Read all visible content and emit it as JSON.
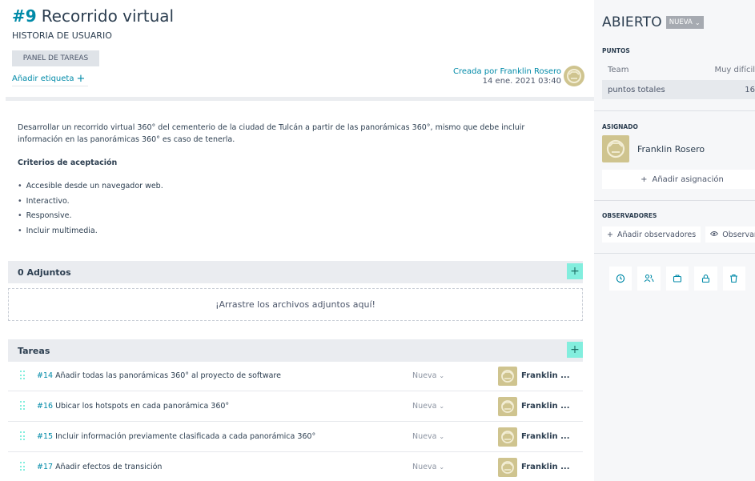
{
  "header": {
    "ref": "#9",
    "title": "Recorrido virtual",
    "type": "HISTORIA DE USUARIO",
    "taskboard_button": "PANEL DE TAREAS",
    "add_tag": "Añadir etiqueta",
    "created_by": "Creada por Franklin Rosero",
    "created_date": "14 ene. 2021 03:40"
  },
  "description": {
    "text": "Desarrollar un recorrido virtual 360° del cementerio de la ciudad de Tulcán a partir de las panorámicas 360°, mismo que debe incluir información en las panorámicas 360° es caso de tenerla.",
    "criteria_title": "Criterios de aceptación",
    "criteria": [
      "Accesible desde un navegador web.",
      "Interactivo.",
      "Responsive.",
      "Incluir multimedia."
    ]
  },
  "attachments": {
    "title": "0 Adjuntos",
    "dropzone": "¡Arrastre los archivos adjuntos aquí!"
  },
  "tasks": {
    "title": "Tareas",
    "items": [
      {
        "ref": "#14",
        "subject": "Añadir todas las panorámicas 360° al proyecto de software",
        "status": "Nueva",
        "assignee": "Franklin ..."
      },
      {
        "ref": "#16",
        "subject": "Ubicar los hotspots en cada panorámica 360°",
        "status": "Nueva",
        "assignee": "Franklin ..."
      },
      {
        "ref": "#15",
        "subject": "Incluir información previamente clasificada a cada panorámica 360°",
        "status": "Nueva",
        "assignee": "Franklin ..."
      },
      {
        "ref": "#17",
        "subject": "Añadir efectos de transición",
        "status": "Nueva",
        "assignee": "Franklin ..."
      }
    ]
  },
  "sidebar": {
    "status": "ABIERTO",
    "status_pill": "NUEVA",
    "points_label": "PUNTOS",
    "points_rows": [
      {
        "label": "Team",
        "value": "Muy difícil"
      },
      {
        "label": "puntos totales",
        "value": "16"
      }
    ],
    "assigned_label": "ASIGNADO",
    "assignee": "Franklin Rosero",
    "add_assignment": "Añadir asignación",
    "watchers_label": "OBSERVADORES",
    "add_watchers": "Añadir observadores",
    "watch": "Observar"
  },
  "icons": {
    "actions": [
      "clock-icon",
      "team-icon",
      "briefcase-icon",
      "lock-icon",
      "trash-icon"
    ]
  },
  "colors": {
    "accent": "#008aa8",
    "add_button": "#83eede",
    "avatar": "#cfc48f"
  }
}
